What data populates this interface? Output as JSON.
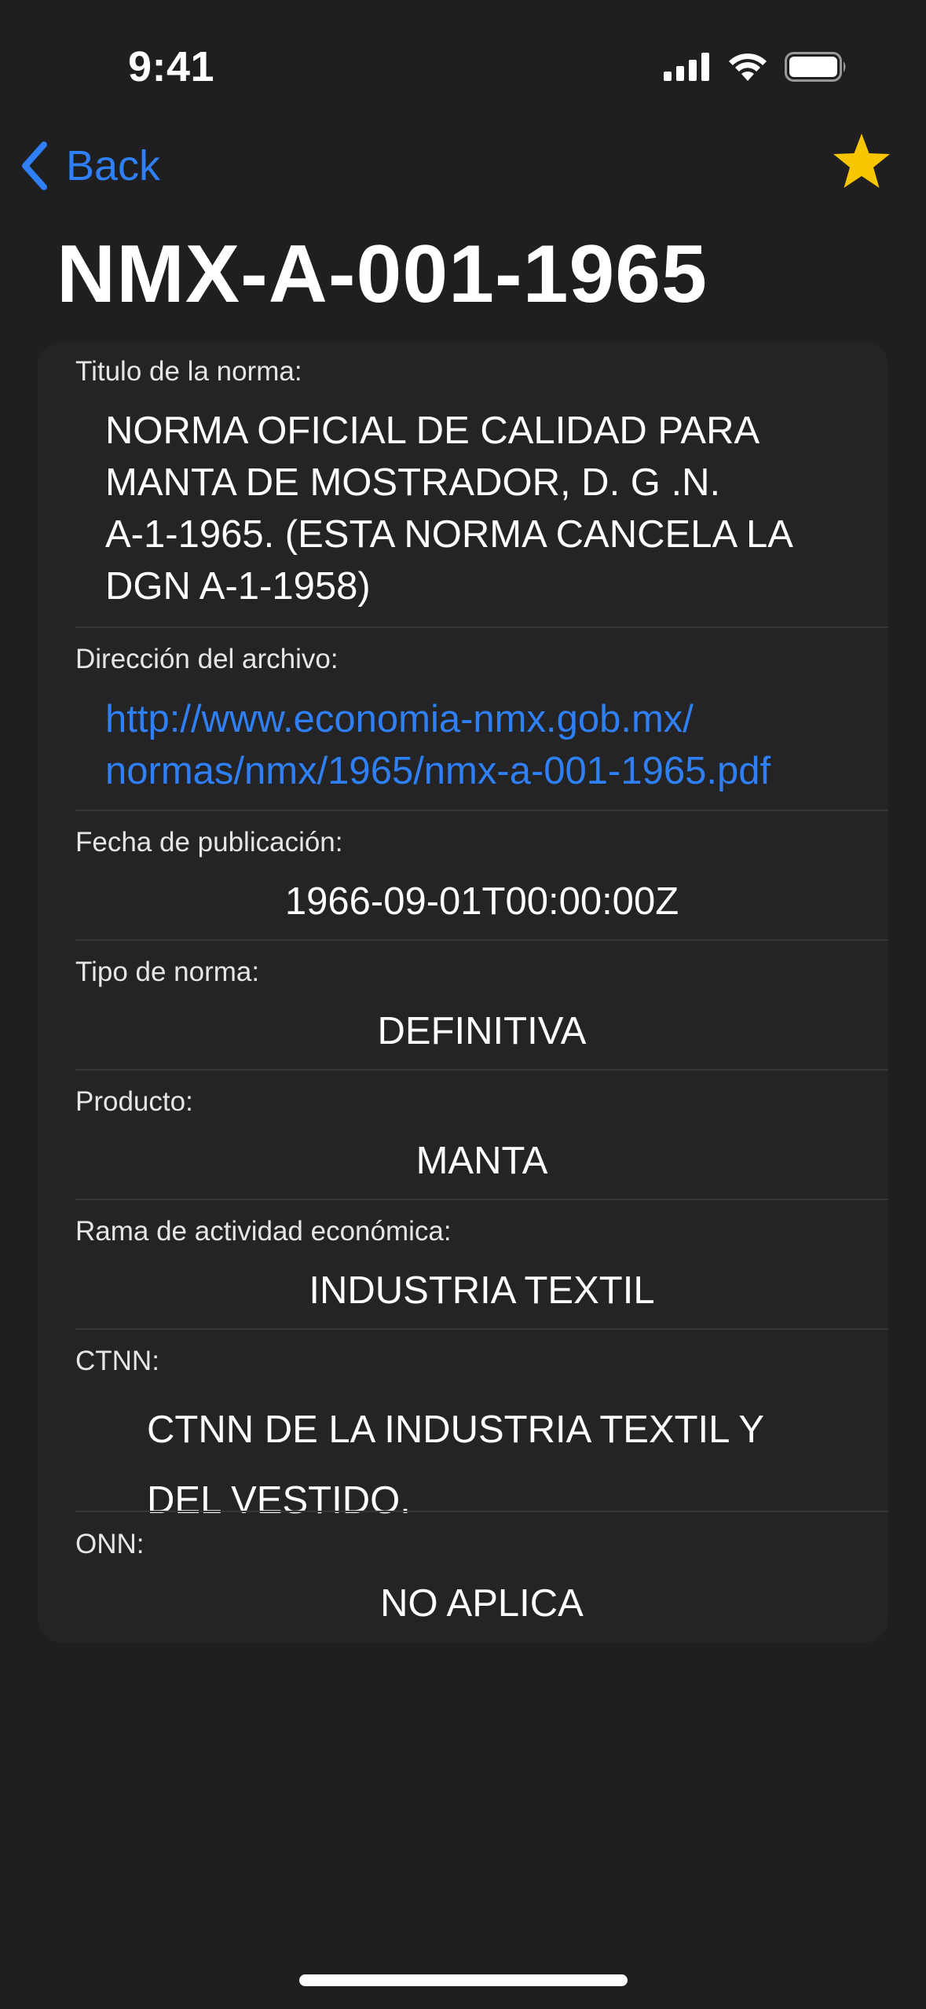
{
  "status_bar": {
    "time": "9:41"
  },
  "nav": {
    "back_label": "Back"
  },
  "title": "NMX-A-001-1965",
  "fields": {
    "titulo": {
      "label": "Titulo de la norma:",
      "lines": [
        "NORMA OFICIAL DE CALIDAD PARA",
        "MANTA DE MOSTRADOR, D. G .N.",
        "A-1-1965. (ESTA NORMA CANCELA LA",
        "DGN A-1-1958)"
      ]
    },
    "direccion": {
      "label": "Dirección del archivo:",
      "lines": [
        "http://www.economia-nmx.gob.mx/",
        "normas/nmx/1965/nmx-a-001-1965.pdf"
      ]
    },
    "fecha": {
      "label": "Fecha de publicación:",
      "value": "1966-09-01T00:00:00Z"
    },
    "tipo": {
      "label": "Tipo de norma:",
      "value": "DEFINITIVA"
    },
    "producto": {
      "label": "Producto:",
      "value": "MANTA"
    },
    "rama": {
      "label": "Rama de actividad económica:",
      "value": "INDUSTRIA TEXTIL"
    },
    "ctnn": {
      "label": "CTNN:",
      "lines": [
        "CTNN DE LA INDUSTRIA TEXTIL Y",
        "DEL VESTIDO."
      ]
    },
    "onn": {
      "label": "ONN:",
      "value": "NO APLICA"
    }
  },
  "colors": {
    "accent": "#2f7ff6",
    "star": "#f7c600",
    "background": "#1f1f21",
    "card": "#242426"
  },
  "icons": [
    "cellular-signal-icon",
    "wifi-icon",
    "battery-icon",
    "chevron-left-icon",
    "star-icon"
  ]
}
